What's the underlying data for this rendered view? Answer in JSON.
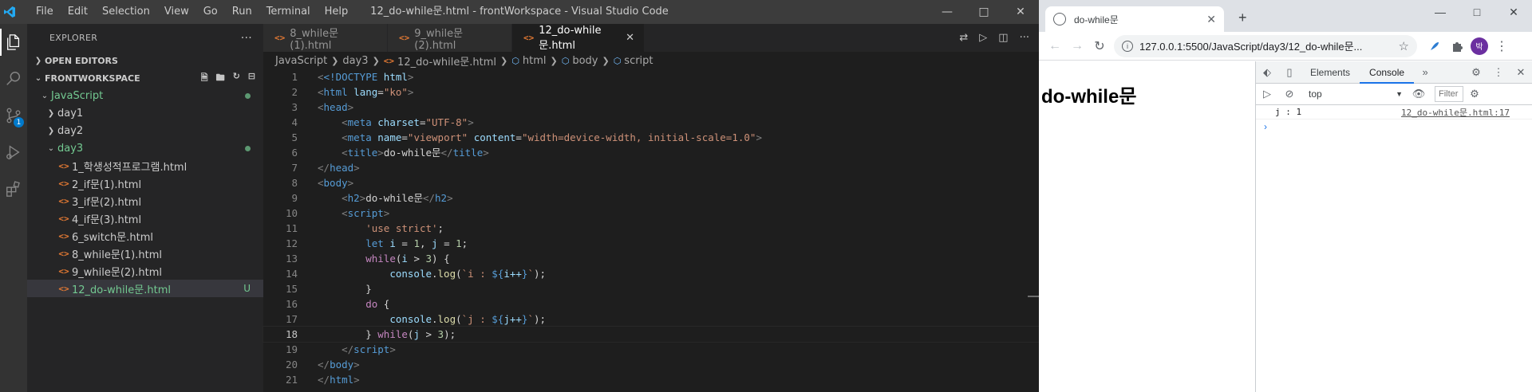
{
  "vscode": {
    "menu": [
      "File",
      "Edit",
      "Selection",
      "View",
      "Go",
      "Run",
      "Terminal",
      "Help"
    ],
    "window_title": "12_do-while문.html - frontWorkspace - Visual Studio Code",
    "source_control_badge": "1",
    "explorer": {
      "title": "EXPLORER",
      "open_editors": "OPEN EDITORS",
      "workspace": "FRONTWORKSPACE",
      "tree": {
        "javascript": "JavaScript",
        "day1": "day1",
        "day2": "day2",
        "day3": "day3",
        "files": [
          "1_학생성적프로그램.html",
          "2_if문(1).html",
          "3_if문(2).html",
          "4_if문(3).html",
          "6_switch문.html",
          "8_while문(1).html",
          "9_while문(2).html",
          "12_do-while문.html"
        ],
        "untracked_marker": "U"
      }
    },
    "tabs": [
      "8_while문(1).html",
      "9_while문(2).html",
      "12_do-while문.html"
    ],
    "breadcrumbs": [
      "JavaScript",
      "day3",
      "12_do-while문.html",
      "html",
      "body",
      "script"
    ],
    "line_numbers": [
      "1",
      "2",
      "3",
      "4",
      "5",
      "6",
      "7",
      "8",
      "9",
      "10",
      "11",
      "12",
      "13",
      "14",
      "15",
      "16",
      "17",
      "18",
      "19",
      "20",
      "21"
    ],
    "code": {
      "l1_doctype": "<!DOCTYPE",
      "l1_html": "html",
      "l2_html": "html",
      "l2_attr": "lang",
      "l2_val": "\"ko\"",
      "head": "head",
      "meta": "meta",
      "charset_attr": "charset",
      "charset_val": "\"UTF-8\"",
      "name_attr": "name",
      "name_val": "\"viewport\"",
      "content_attr": "content",
      "content_val": "\"width=device-width, initial-scale=1.0\"",
      "title": "title",
      "title_text": "do-while문",
      "body": "body",
      "h2": "h2",
      "h2_text": "do-while문",
      "script": "script",
      "use_strict": "'use strict'",
      "let": "let",
      "i": "i",
      "j": "j",
      "one": "1",
      "three": "3",
      "while": "while",
      "do": "do",
      "console": "console",
      "log": "log",
      "tpl_i_start": "`i : ",
      "tpl_j_start": "`j : ",
      "i_inc": "i++",
      "j_inc": "j++",
      "tpl_end": "`"
    }
  },
  "chrome": {
    "tab_title": "do-while문",
    "url": "127.0.0.1:5500/JavaScript/day3/12_do-while문...",
    "avatar": "박",
    "page_heading": "do-while문",
    "devtools": {
      "tabs": [
        "Elements",
        "Console"
      ],
      "context": "top",
      "filter_placeholder": "Filter",
      "log_text": "j : 1",
      "log_source": "12_do-while문.html:17",
      "prompt": "›"
    }
  }
}
